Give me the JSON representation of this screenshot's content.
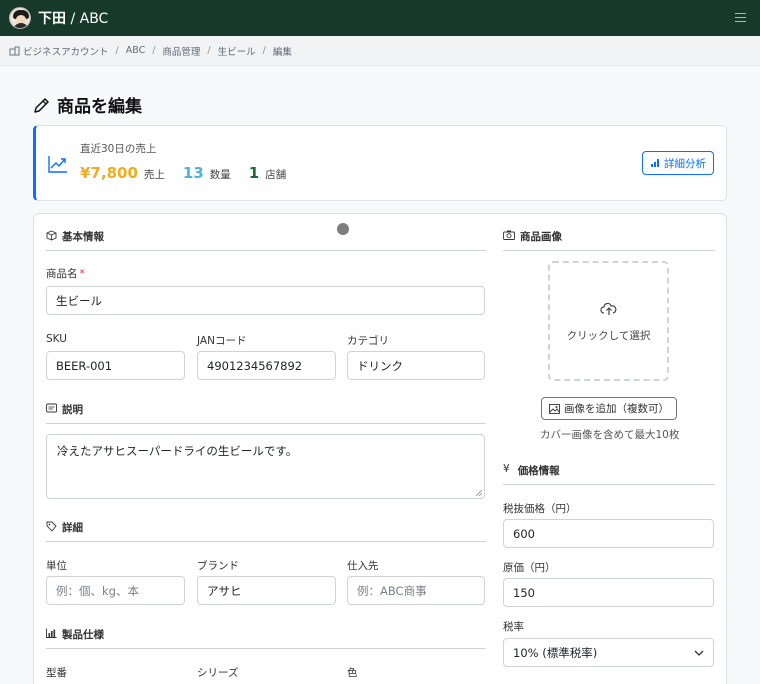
{
  "header": {
    "user": "下田",
    "separator": " / ",
    "org": "ABC",
    "menu_icon": "hamburger-icon"
  },
  "breadcrumb": {
    "icon": "building-icon",
    "items": [
      "ビジネスアカウント",
      "ABC",
      "商品管理",
      "生ビール",
      "編集"
    ],
    "separator": "/"
  },
  "page": {
    "title": "商品を編集",
    "title_icon": "pencil-icon"
  },
  "stats": {
    "label": "直近30日の売上",
    "sales_value": "¥7,800",
    "sales_unit": "売上",
    "quantity_value": "13",
    "quantity_unit": "数量",
    "stores_value": "1",
    "stores_unit": "店舗",
    "detail_button": "詳細分析",
    "colors": {
      "accent": "#0d6efd",
      "sales": "#f0ad1f",
      "quantity": "#4fb3d9",
      "stores": "#1d6b3a"
    }
  },
  "basic": {
    "heading": "基本情報",
    "name_label": "商品名",
    "required_mark": "*",
    "name_value": "生ビール",
    "sku_label": "SKU",
    "sku_value": "BEER-001",
    "jan_label": "JANコード",
    "jan_value": "4901234567892",
    "category_label": "カテゴリ",
    "category_value": "ドリンク"
  },
  "description": {
    "heading": "説明",
    "value": "冷えたアサヒスーパードライの生ビールです。"
  },
  "details": {
    "heading": "詳細",
    "unit_label": "単位",
    "unit_placeholder": "例：個、kg、本",
    "brand_label": "ブランド",
    "brand_value": "アサヒ",
    "supplier_label": "仕入先",
    "supplier_placeholder": "例：ABC商事"
  },
  "specs": {
    "heading": "製品仕様",
    "model_label": "型番",
    "series_label": "シリーズ",
    "color_label": "色"
  },
  "images": {
    "heading": "商品画像",
    "upload_text": "クリックして選択",
    "add_button": "画像を追加（複数可）",
    "hint": "カバー画像を含めて最大10枚"
  },
  "pricing": {
    "heading": "価格情報",
    "heading_icon": "yen-icon",
    "price_label": "税抜価格（円）",
    "price_value": "600",
    "cost_label": "原価（円）",
    "cost_value": "150",
    "tax_label": "税率",
    "tax_value": "10% (標準税率)"
  }
}
